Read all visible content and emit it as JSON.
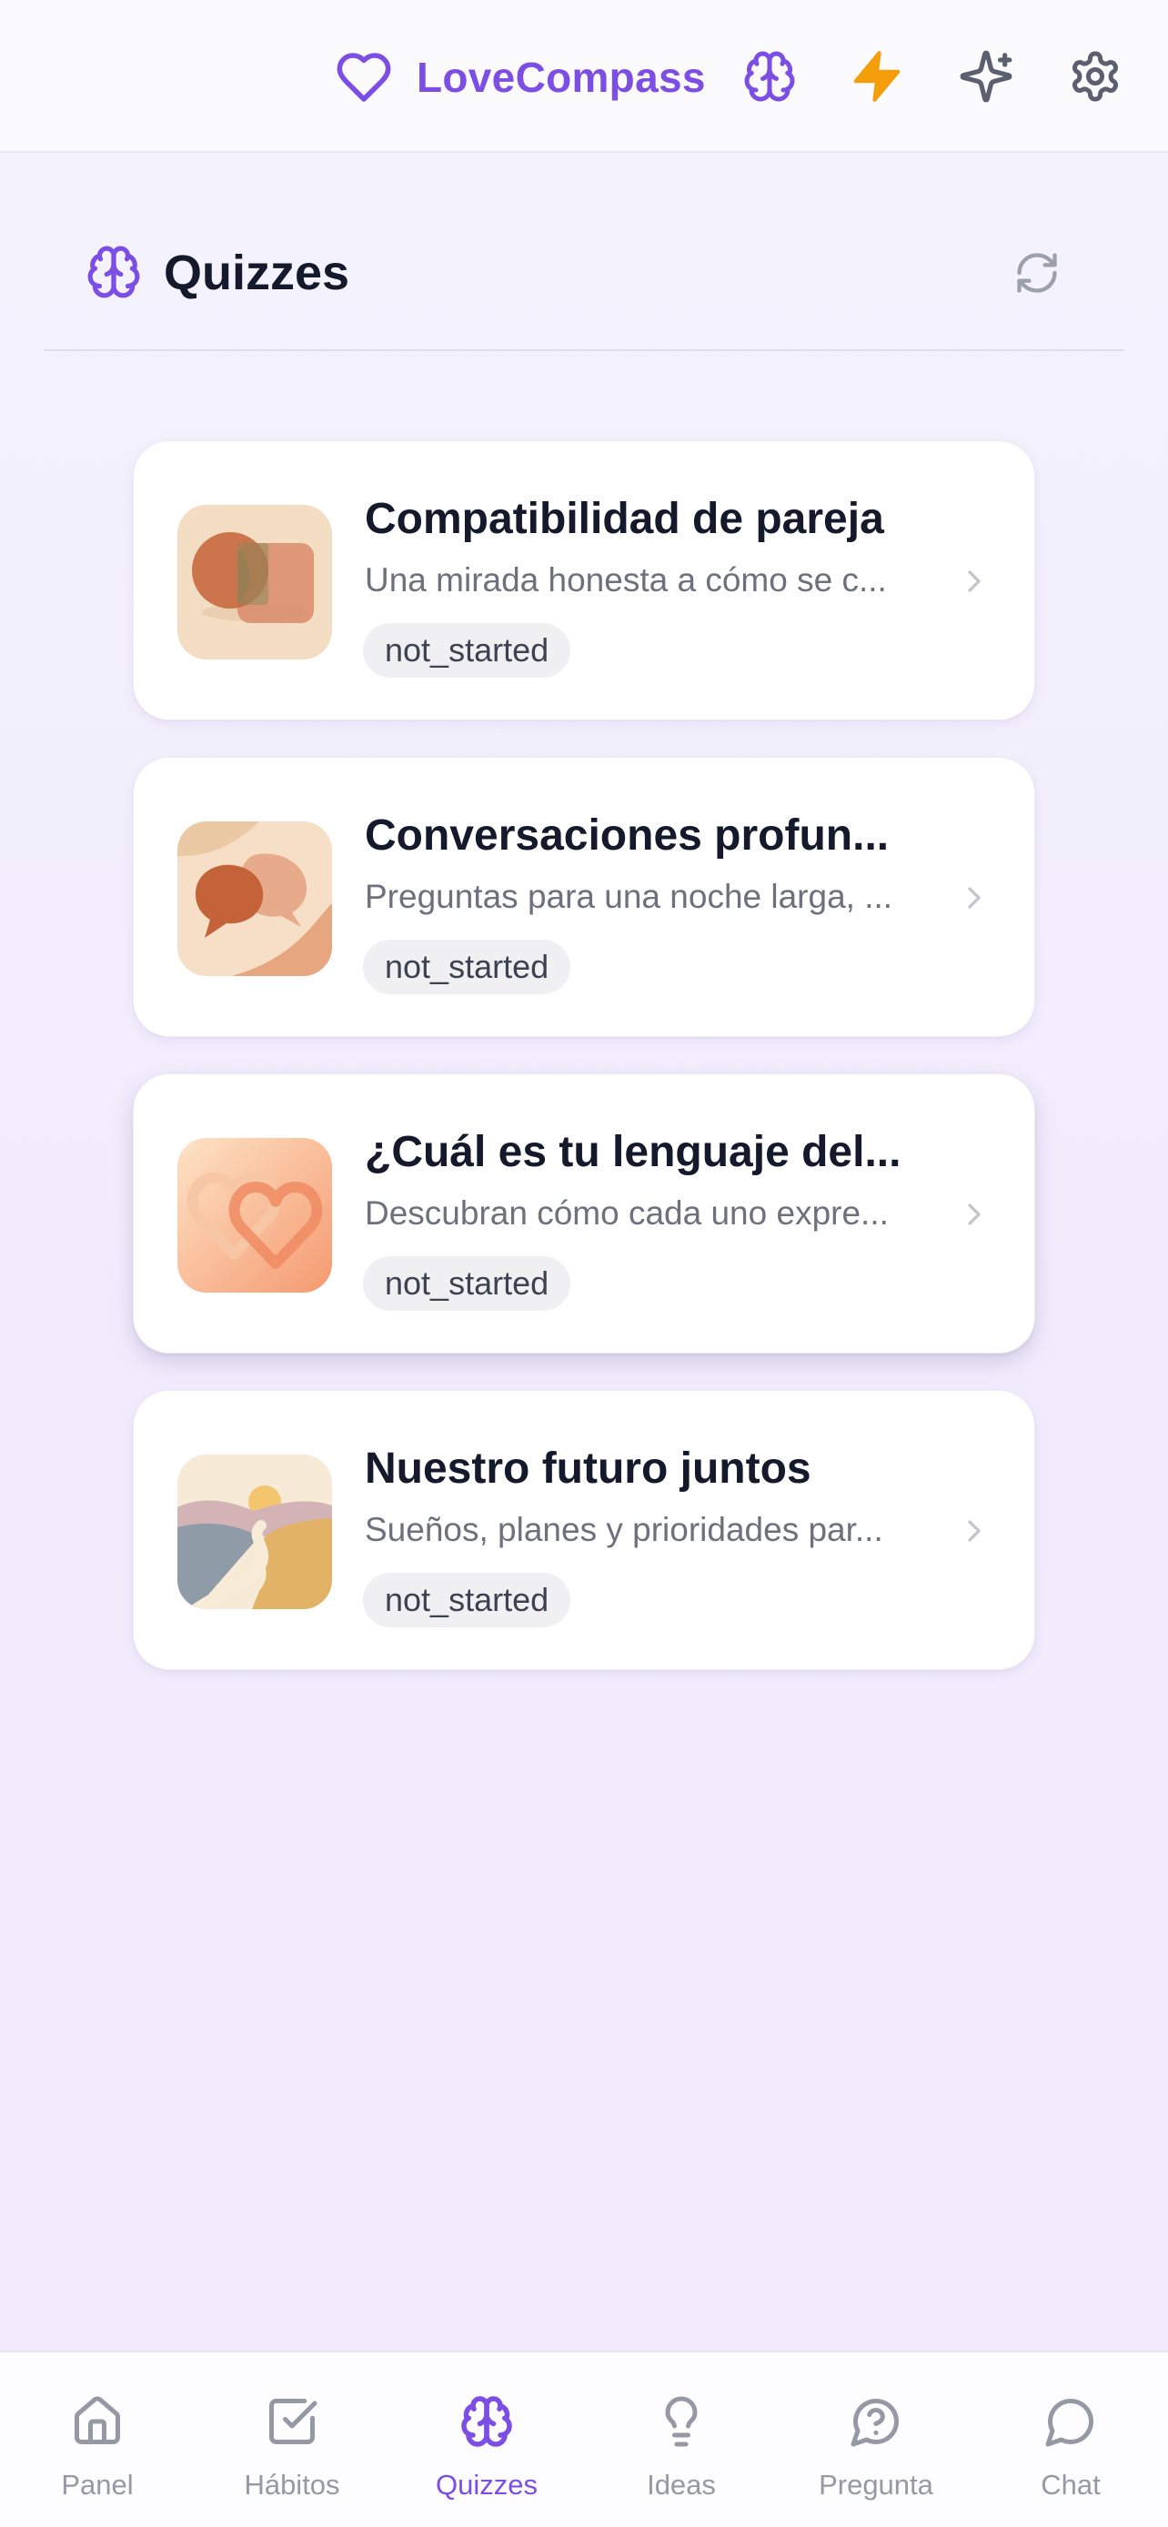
{
  "header": {
    "app_name": "LoveCompass",
    "icons": [
      "heart-icon",
      "brain-icon",
      "bolt-icon",
      "sparkles-icon",
      "gear-icon"
    ],
    "colors": {
      "brand": "#7c4ee4",
      "bolt": "#f59e0b",
      "icon_gray": "#5b5f70"
    }
  },
  "section": {
    "title": "Quizzes",
    "icon": "brain-icon",
    "refresh_icon": "refresh-icon"
  },
  "quizzes": [
    {
      "title": "Compatibilidad de pareja",
      "description": "Una mirada honesta a cómo se c...",
      "status": "not_started",
      "thumbnail": "overlapping-shapes"
    },
    {
      "title": "Conversaciones profun...",
      "description": "Preguntas para una noche larga, ...",
      "status": "not_started",
      "thumbnail": "speech-bubbles"
    },
    {
      "title": "¿Cuál es tu lenguaje del...",
      "description": "Descubran cómo cada uno expre...",
      "status": "not_started",
      "thumbnail": "interlocked-hearts"
    },
    {
      "title": "Nuestro futuro juntos",
      "description": "Sueños, planes y prioridades par...",
      "status": "not_started",
      "thumbnail": "landscape-path"
    }
  ],
  "nav": {
    "items": [
      {
        "label": "Panel",
        "icon": "home-icon"
      },
      {
        "label": "Hábitos",
        "icon": "checkbox-icon"
      },
      {
        "label": "Quizzes",
        "icon": "brain-icon",
        "active": true
      },
      {
        "label": "Ideas",
        "icon": "lightbulb-icon"
      },
      {
        "label": "Pregunta",
        "icon": "question-icon"
      },
      {
        "label": "Chat",
        "icon": "chat-bubble-icon"
      }
    ],
    "colors": {
      "active": "#7c4ee4",
      "inactive": "#9599a6"
    }
  }
}
